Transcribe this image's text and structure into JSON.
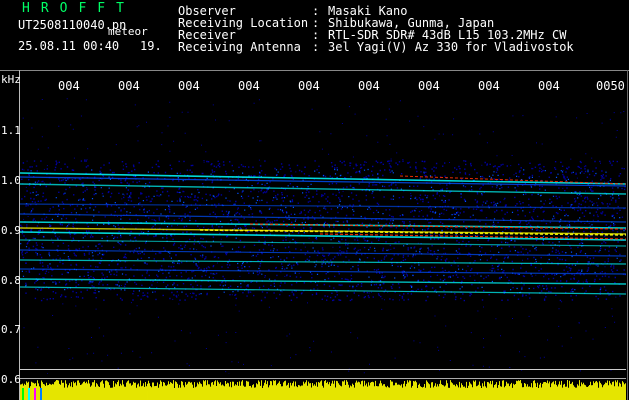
{
  "header": {
    "app_title": "HROFFT",
    "file_name": "UT2508110040.pn",
    "file_suffix": "meteor",
    "datetime": "25.08.11 00:40",
    "sample_number": "19.",
    "rows": [
      {
        "label": "Observer",
        "value": "Masaki Kano"
      },
      {
        "label": "Receiving Location",
        "value": "Shibukawa, Gunma, Japan"
      },
      {
        "label": "Receiver",
        "value": "RTL-SDR SDR# 43dB L15 103.2MHz CW"
      },
      {
        "label": "Receiving Antenna",
        "value": "3el Yagi(V) Az 330 for Vladivostok"
      }
    ]
  },
  "plot": {
    "y_unit": "kHz",
    "y_ticks": [
      "1.1",
      "1.0",
      "0.9",
      "0.8",
      "0.7",
      "0.6"
    ],
    "x_ticks": [
      "004",
      "004",
      "004",
      "004",
      "004",
      "004",
      "004",
      "004",
      "004",
      "0050"
    ],
    "colors": {
      "background": "#000000",
      "text": "#ffffff",
      "title": "#00ff66",
      "noise": "#0000a0",
      "signal_low": "#0050ff",
      "signal_mid": "#00ffff",
      "signal_high": "#ffff00",
      "signal_peak": "#ff3000",
      "level_bars": "#ffff00"
    }
  }
}
